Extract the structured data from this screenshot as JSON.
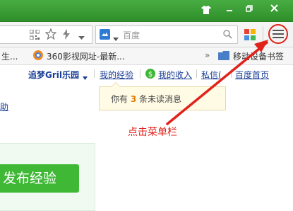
{
  "titlebar": {
    "color": "#3b9e36",
    "buttons": [
      "tshirt-icon",
      "minimize-icon",
      "restore-icon",
      "close-icon"
    ]
  },
  "toolbar": {
    "search": {
      "engine_icon": "search-engine-icon",
      "text": "百度"
    }
  },
  "bookmarks": {
    "items": [
      {
        "label": "生..."
      },
      {
        "label": "360影视网址-最新..."
      }
    ],
    "more": "»",
    "mobile_label": "移动设备书签"
  },
  "userbar": {
    "username": "追梦Gril乐园",
    "my_experience": "我的经验",
    "my_income": "我的收入",
    "messages": "私信(",
    "baidu_home": "百度首页"
  },
  "notice": {
    "prefix": "你有",
    "count": "3",
    "suffix": "条未读消息"
  },
  "side_link": "助",
  "publish_button": "发布经验",
  "annotation": {
    "text": "点击菜单栏",
    "color": "#e0221b"
  }
}
